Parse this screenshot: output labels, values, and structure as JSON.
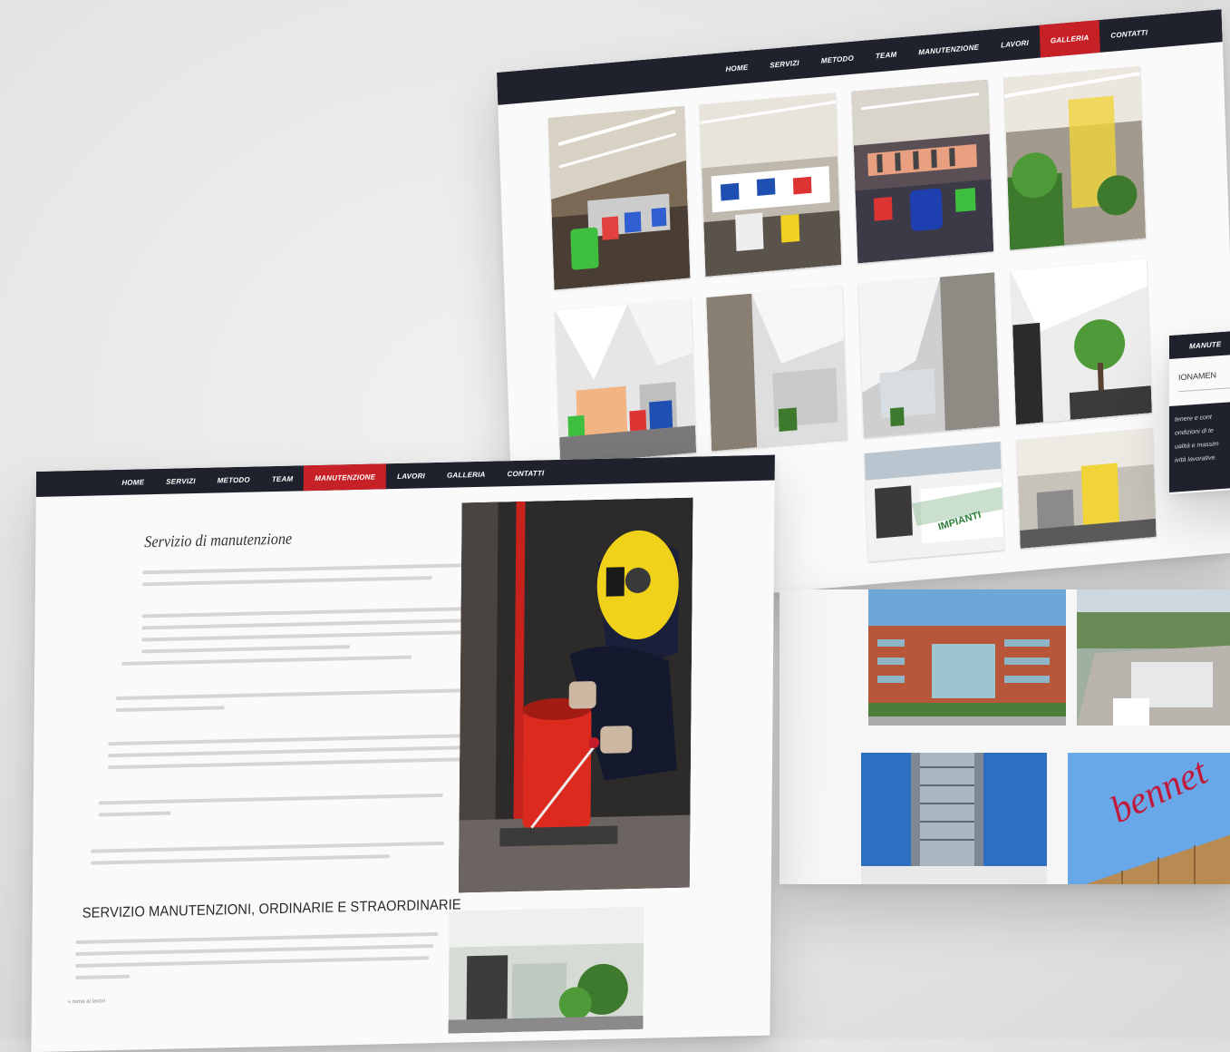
{
  "colors": {
    "navbar": "#1f222c",
    "active": "#c62127",
    "panel": "#fafafa"
  },
  "gallery": {
    "nav": [
      "HOME",
      "SERVIZI",
      "METODO",
      "TEAM",
      "MANUTENZIONE",
      "LAVORI",
      "GALLERIA",
      "CONTATTI"
    ],
    "active": "GALLERIA"
  },
  "side": {
    "nav": [
      "MANUTE"
    ],
    "heading": "IONAMEN",
    "text": [
      "tenere e cont",
      "ondizioni di te",
      "ualità e massim",
      "ività lavorative."
    ]
  },
  "projects": {
    "sign": "bennet"
  },
  "manutenzione": {
    "nav": [
      "HOME",
      "SERVIZI",
      "METODO",
      "TEAM",
      "MANUTENZIONE",
      "LAVORI",
      "GALLERIA",
      "CONTATTI"
    ],
    "active": "MANUTENZIONE",
    "title": "Servizio di manutenzione",
    "section_heading": "SERVIZIO MANUTENZIONI, ORDINARIE E STRAORDINARIE",
    "back_link": "« torna ai lavori"
  },
  "truck": {
    "logo": "IMPIANTI"
  }
}
